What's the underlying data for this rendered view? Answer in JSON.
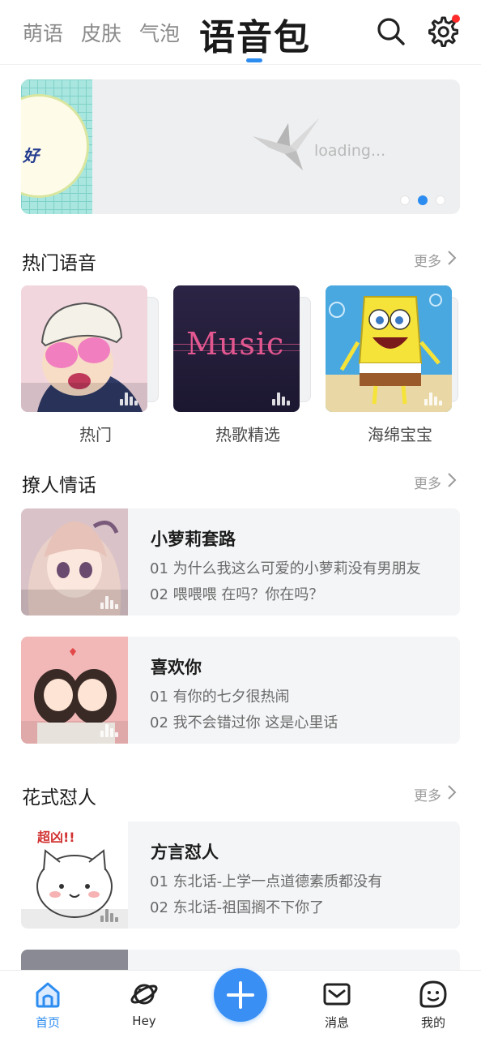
{
  "tabs": {
    "items": [
      "萌语",
      "皮肤",
      "气泡"
    ],
    "active": "语音包"
  },
  "banner": {
    "bubble_text": "好",
    "loading_text": "loading...",
    "page_count": 3,
    "active_page": 2
  },
  "hot_section": {
    "title": "热门语音",
    "more": "更多",
    "cards": [
      {
        "label": "热门"
      },
      {
        "label": "热歌精选",
        "art_text": "Music"
      },
      {
        "label": "海绵宝宝"
      }
    ]
  },
  "flirt_section": {
    "title": "撩人情话",
    "more": "更多",
    "items": [
      {
        "title": "小萝莉套路",
        "line1": "01 为什么我这么可爱的小萝莉没有男朋友",
        "line2": "02 喂喂喂 在吗？你在吗？"
      },
      {
        "title": "喜欢你",
        "line1": "01 有你的七夕很热闹",
        "line2": "02 我不会错过你 这是心里话"
      }
    ]
  },
  "roast_section": {
    "title": "花式怼人",
    "more": "更多",
    "items": [
      {
        "title": "方言怼人",
        "line1": "01 东北话-上学一点道德素质都没有",
        "line2": "02 东北话-祖国搁不下你了",
        "sticker_text": "超凶!!"
      }
    ]
  },
  "nav": {
    "home": "首页",
    "hey": "Hey",
    "messages": "消息",
    "me": "我的"
  },
  "colors": {
    "accent": "#2d8cf0",
    "badge": "#ff2b2b"
  }
}
